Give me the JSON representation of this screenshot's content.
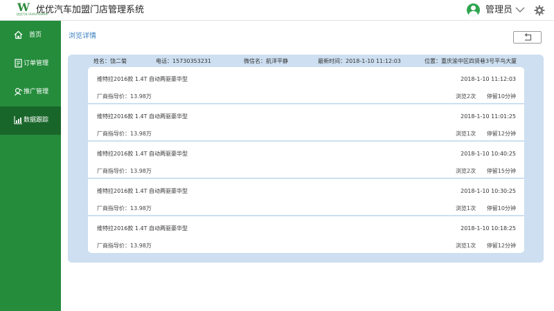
{
  "header": {
    "logo_text": "W",
    "logo_sub": "优优汽车 UUAUTOSHOP",
    "title": "优优汽车加盟门店管理系统",
    "user_name": "管理员",
    "icons": {
      "avatar": "user-avatar-icon",
      "dropdown": "chevron-down-icon",
      "settings": "gear-icon"
    }
  },
  "colors": {
    "sidebar": "#258c3c",
    "sidebar_active": "#19662a",
    "panel": "#cddff0",
    "title_link": "#3b7fbf"
  },
  "sidebar": {
    "items": [
      {
        "label": "首页",
        "icon": "home-icon",
        "active": false
      },
      {
        "label": "订单管理",
        "icon": "order-icon",
        "active": false
      },
      {
        "label": "推广管理",
        "icon": "promotion-icon",
        "active": false
      },
      {
        "label": "数据跟踪",
        "icon": "chart-icon",
        "active": true
      }
    ]
  },
  "main": {
    "title": "浏览详情",
    "back_icon": "return-icon",
    "info": {
      "name": "姓名：饶二菊",
      "phone": "电话：15730353231",
      "wechat": "微信名：航洋平静",
      "latest_time": "最新时间：2018-1-10  11:12:03",
      "location": "位置：重庆渝中区四贤巷3号平鸟大厦"
    },
    "records": [
      {
        "model": "维特拉2016款 1.4T 自动两驱豪华型",
        "time": "2018-1-10  11:12:03",
        "price": "厂商指导价：13.98万",
        "views": "浏览2次",
        "stay": "停留10分钟"
      },
      {
        "model": "维特拉2016款 1.4T 自动两驱豪华型",
        "time": "2018-1-10  11:01:25",
        "price": "厂商指导价：13.98万",
        "views": "浏览1次",
        "stay": "停留12分钟"
      },
      {
        "model": "维特拉2016款 1.4T 自动两驱豪华型",
        "time": "2018-1-10  10:40:25",
        "price": "厂商指导价：13.98万",
        "views": "浏览2次",
        "stay": "停留15分钟"
      },
      {
        "model": "维特拉2016款 1.4T 自动两驱豪华型",
        "time": "2018-1-10  10:30:25",
        "price": "厂商指导价：13.98万",
        "views": "浏览1次",
        "stay": "停留10分钟"
      },
      {
        "model": "维特拉2016款 1.4T 自动两驱豪华型",
        "time": "2018-1-10  10:18:25",
        "price": "厂商指导价：13.98万",
        "views": "浏览1次",
        "stay": "停留12分钟"
      }
    ]
  }
}
